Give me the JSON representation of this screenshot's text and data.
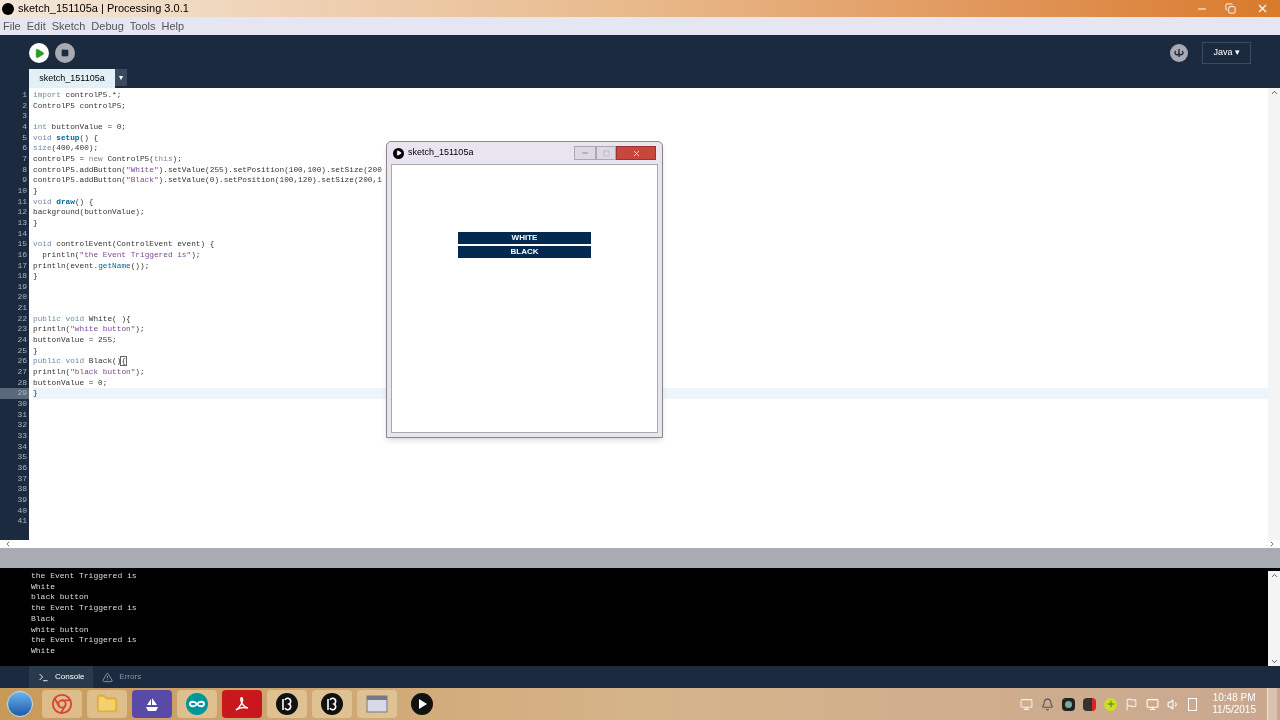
{
  "window": {
    "title": "sketch_151105a | Processing 3.0.1"
  },
  "menu": [
    "File",
    "Edit",
    "Sketch",
    "Debug",
    "Tools",
    "Help"
  ],
  "toolbar": {
    "mode": "Java ▾"
  },
  "tabs": [
    {
      "label": "sketch_151105a",
      "selected": true
    }
  ],
  "tab_menu": "▾",
  "editor": {
    "lines": [
      {
        "n": "1",
        "selected": false,
        "seg": [
          {
            "kind": "kw",
            "text": "import"
          },
          {
            "kind": "p",
            "text": " controlP5.*;"
          }
        ]
      },
      {
        "n": "2",
        "selected": false,
        "seg": [
          {
            "kind": "p",
            "text": "ControlP5 controlP5;"
          }
        ]
      },
      {
        "n": "3",
        "selected": false
      },
      {
        "n": "4",
        "selected": false,
        "seg": [
          {
            "kind": "kw",
            "text": "int"
          },
          {
            "kind": "p",
            "text": " buttonValue = 0;"
          }
        ]
      },
      {
        "n": "5",
        "selected": false,
        "seg": [
          {
            "kind": "kw",
            "text": "void "
          },
          {
            "kind": "fn",
            "text": "setup"
          },
          {
            "kind": "p",
            "text": "() {"
          }
        ]
      },
      {
        "n": "6",
        "selected": false,
        "seg": [
          {
            "kind": "kw",
            "text": "size"
          },
          {
            "kind": "p",
            "text": "(400,400);"
          }
        ]
      },
      {
        "n": "7",
        "selected": false,
        "seg": [
          {
            "kind": "p",
            "text": "controlP5 = "
          },
          {
            "kind": "kw",
            "text": "new"
          },
          {
            "kind": "p",
            "text": " ControlP5("
          },
          {
            "kind": "kw",
            "text": "this"
          },
          {
            "kind": "p",
            "text": ");"
          }
        ]
      },
      {
        "n": "8",
        "selected": false,
        "seg": [
          {
            "kind": "p",
            "text": "controlP5.addButton("
          },
          {
            "kind": "str",
            "text": "\"White\""
          },
          {
            "kind": "p",
            "text": ").setValue(255).setPosition(100,100).setSize(200"
          }
        ]
      },
      {
        "n": "9",
        "selected": false,
        "seg": [
          {
            "kind": "p",
            "text": "controlP5.addButton("
          },
          {
            "kind": "str",
            "text": "\"Black\""
          },
          {
            "kind": "p",
            "text": ").setValue(0).setPosition(100,120).setSize(200,1"
          }
        ]
      },
      {
        "n": "10",
        "selected": false,
        "seg": [
          {
            "kind": "p",
            "text": "}"
          }
        ]
      },
      {
        "n": "11",
        "selected": false,
        "seg": [
          {
            "kind": "kw",
            "text": "void "
          },
          {
            "kind": "fn",
            "text": "draw"
          },
          {
            "kind": "p",
            "text": "() {"
          }
        ]
      },
      {
        "n": "12",
        "selected": false,
        "seg": [
          {
            "kind": "p",
            "text": "background(buttonValue);"
          }
        ]
      },
      {
        "n": "13",
        "selected": false,
        "seg": [
          {
            "kind": "p",
            "text": "}"
          }
        ]
      },
      {
        "n": "14",
        "selected": false
      },
      {
        "n": "15",
        "selected": false,
        "seg": [
          {
            "kind": "kw",
            "text": "void"
          },
          {
            "kind": "p",
            "text": " controlEvent(ControlEvent event) {"
          }
        ]
      },
      {
        "n": "16",
        "selected": false,
        "seg": [
          {
            "kind": "p",
            "text": "  println("
          },
          {
            "kind": "str",
            "text": "\"the Event Triggered is\""
          },
          {
            "kind": "p",
            "text": ");"
          }
        ]
      },
      {
        "n": "17",
        "selected": false,
        "seg": [
          {
            "kind": "p",
            "text": "println(event."
          },
          {
            "kind": "m",
            "text": "getName"
          },
          {
            "kind": "p",
            "text": "());"
          }
        ]
      },
      {
        "n": "18",
        "selected": false,
        "seg": [
          {
            "kind": "p",
            "text": "}"
          }
        ]
      },
      {
        "n": "19",
        "selected": false
      },
      {
        "n": "20",
        "selected": false
      },
      {
        "n": "21",
        "selected": false
      },
      {
        "n": "22",
        "selected": false,
        "seg": [
          {
            "kind": "kw",
            "text": "public void"
          },
          {
            "kind": "p",
            "text": " White( ){"
          }
        ]
      },
      {
        "n": "23",
        "selected": false,
        "seg": [
          {
            "kind": "p",
            "text": "println("
          },
          {
            "kind": "str",
            "text": "\"white button\""
          },
          {
            "kind": "p",
            "text": ");"
          }
        ]
      },
      {
        "n": "24",
        "selected": false,
        "seg": [
          {
            "kind": "p",
            "text": "buttonValue = 255;"
          }
        ]
      },
      {
        "n": "25",
        "selected": false,
        "seg": [
          {
            "kind": "p",
            "text": "}"
          }
        ]
      },
      {
        "n": "26",
        "selected": false,
        "seg": [
          {
            "kind": "kw",
            "text": "public void"
          },
          {
            "kind": "p",
            "text": " Black()"
          },
          {
            "kind": "match",
            "text": "{"
          }
        ]
      },
      {
        "n": "27",
        "selected": false,
        "seg": [
          {
            "kind": "p",
            "text": "println("
          },
          {
            "kind": "str",
            "text": "\"black button\""
          },
          {
            "kind": "p",
            "text": ");"
          }
        ]
      },
      {
        "n": "28",
        "selected": false,
        "seg": [
          {
            "kind": "p",
            "text": "buttonValue = 0;"
          }
        ]
      },
      {
        "n": "29",
        "selected": true,
        "seg": [
          {
            "kind": "p",
            "text": "}"
          }
        ]
      },
      {
        "n": "30",
        "selected": false
      },
      {
        "n": "31",
        "selected": false
      },
      {
        "n": "32",
        "selected": false
      },
      {
        "n": "33",
        "selected": false
      },
      {
        "n": "34",
        "selected": false
      },
      {
        "n": "35",
        "selected": false
      },
      {
        "n": "36",
        "selected": false
      },
      {
        "n": "37",
        "selected": false
      },
      {
        "n": "38",
        "selected": false
      },
      {
        "n": "39",
        "selected": false
      },
      {
        "n": "40",
        "selected": false
      },
      {
        "n": "41",
        "selected": false
      }
    ]
  },
  "sketch_window": {
    "title": "sketch_151105a",
    "buttons": [
      "WHITE",
      "BLACK"
    ]
  },
  "console": {
    "lines": [
      "the Event Triggered is",
      "White",
      "black button",
      "the Event Triggered is",
      "Black",
      "white button",
      "the Event Triggered is",
      "White"
    ]
  },
  "console_tabs": [
    {
      "label": "Console",
      "selected": true
    },
    {
      "label": "Errors",
      "selected": false
    }
  ],
  "taskbar": {
    "time": "10:48 PM",
    "date": "11/5/2015"
  }
}
